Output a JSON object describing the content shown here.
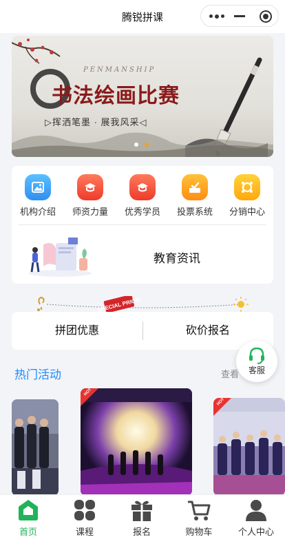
{
  "app": {
    "title": "腾锐拼课"
  },
  "banner": {
    "en_text": "PENMANSHIP",
    "title": "书法绘画比赛",
    "subtitle": "▷挥洒笔墨 · 展我风采◁",
    "slide_count": 2,
    "active_slide": 1,
    "colors": {
      "dot_active": "#f0a020",
      "dot_inactive": "#ffffff"
    }
  },
  "menu": {
    "items": [
      {
        "label": "机构介绍",
        "icon": "image-icon",
        "color": "#3ba8f5"
      },
      {
        "label": "师资力量",
        "icon": "teacher-icon",
        "color": "#f55a3c"
      },
      {
        "label": "优秀学员",
        "icon": "student-icon",
        "color": "#f55a3c"
      },
      {
        "label": "投票系统",
        "icon": "vote-icon",
        "color": "#ffa21a"
      },
      {
        "label": "分销中心",
        "icon": "distribution-icon",
        "color": "#ffbe12"
      }
    ],
    "news_label": "教育资讯"
  },
  "decor_badge": "SPECIAL PRICE!",
  "promo": {
    "group_buy": "拼团优惠",
    "bargain": "砍价报名"
  },
  "service": {
    "label": "客服",
    "icon": "headset-icon"
  },
  "hot": {
    "title": "热门活动",
    "view_all": "查看",
    "badge": "HOT"
  },
  "tabbar": {
    "active_color": "#21b35a",
    "items": [
      {
        "label": "首页",
        "icon": "home-icon",
        "active": true
      },
      {
        "label": "课程",
        "icon": "grid-icon",
        "active": false
      },
      {
        "label": "报名",
        "icon": "gift-icon",
        "active": false
      },
      {
        "label": "购物车",
        "icon": "cart-icon",
        "active": false
      },
      {
        "label": "个人中心",
        "icon": "user-icon",
        "active": false
      }
    ]
  }
}
